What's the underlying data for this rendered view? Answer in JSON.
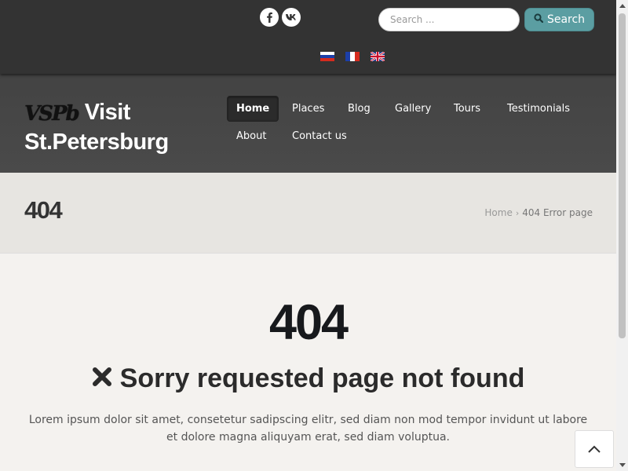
{
  "top_bar": {
    "social": [
      {
        "name": "facebook-icon",
        "glyph": "f"
      },
      {
        "name": "vk-icon",
        "glyph": "vk"
      }
    ],
    "search": {
      "placeholder": "Search ...",
      "button_label": "Search",
      "button_icon": "search-icon"
    },
    "languages": [
      {
        "code": "ru",
        "flag": "russia-flag-icon"
      },
      {
        "code": "fr",
        "flag": "france-flag-icon"
      },
      {
        "code": "en",
        "flag": "uk-flag-icon"
      }
    ]
  },
  "header": {
    "logo_mark": "VSPb",
    "logo_line1": "Visit",
    "logo_line2": "St.Petersburg",
    "nav": [
      "Home",
      "Places",
      "Blog",
      "Gallery",
      "Tours",
      "Testimonials",
      "About",
      "Contact us"
    ],
    "active_nav": "Home"
  },
  "title_bar": {
    "title": "404",
    "breadcrumb": {
      "home": "Home",
      "separator": "›",
      "current": "404 Error page"
    }
  },
  "main": {
    "code": "404",
    "heading_icon": "close-icon",
    "heading": "Sorry requested page not found",
    "text": "Lorem ipsum dolor sit amet, consetetur sadipscing elitr, sed diam non mod tempor invidunt ut labore et dolore magna aliquyam erat, sed diam voluptua."
  },
  "colors": {
    "topbar": "#333333",
    "header": "#464646",
    "accent_button": "#5b9ea2",
    "title_strip": "#e7e5e1",
    "page_bg": "#f4f2ef"
  }
}
